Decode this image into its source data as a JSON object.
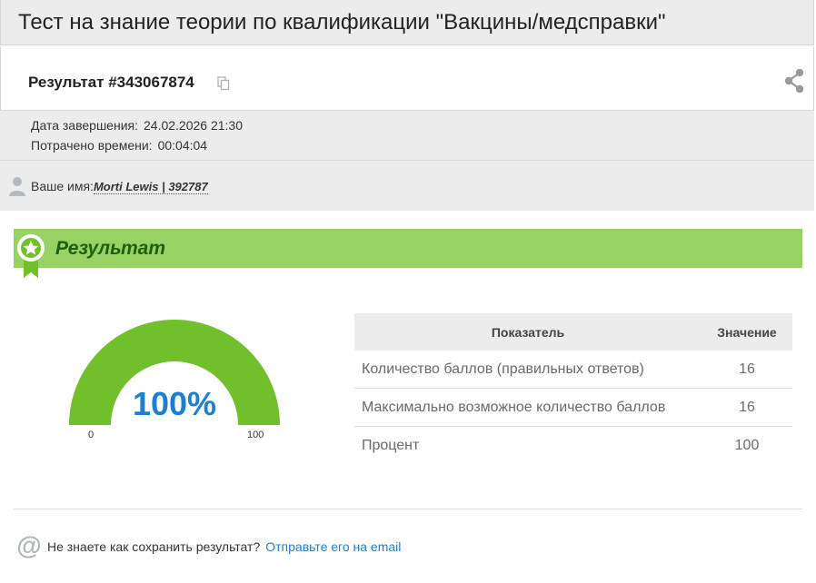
{
  "header": {
    "title": "Тест на знание теории по квалификации \"Вакцины/медсправки\""
  },
  "result": {
    "id_label": "Результат #343067874"
  },
  "meta": {
    "finish_label": "Дата завершения:",
    "finish_value": "24.02.2026 21:30",
    "time_label": "Потрачено времени:",
    "time_value": "00:04:04",
    "user_label": "Ваше имя:",
    "user_name": "Morti Lewis | 392787"
  },
  "banner": {
    "title": "Результат"
  },
  "gauge": {
    "value_label": "100%",
    "value": 100,
    "min_label": "0",
    "max_label": "100",
    "fill_color": "#72bf2c"
  },
  "table": {
    "headers": [
      "Показатель",
      "Значение"
    ],
    "rows": [
      {
        "label": "Количество баллов (правильных ответов)",
        "value": "16"
      },
      {
        "label": "Максимально возможное количество баллов",
        "value": "16"
      },
      {
        "label": "Процент",
        "value": "100"
      }
    ]
  },
  "footer": {
    "question": "Не знаете как сохранить результат?",
    "link": "Отправьте его на email"
  },
  "colors": {
    "accent": "#1d7fd1",
    "banner": "#98d264",
    "banner_text": "#1f5f0a"
  }
}
